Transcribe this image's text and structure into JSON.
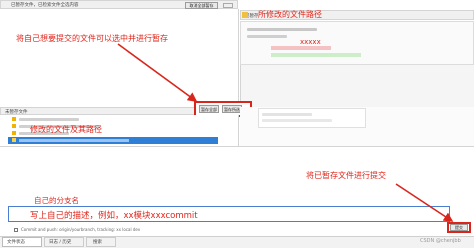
{
  "left_top": {
    "header_label": "已暂存文件，已检索文件全选内容",
    "header_button": "取消全部暂存",
    "annotation": "将自己想要提交的文件可以选中并进行暂存"
  },
  "right_top": {
    "header_label": "已暂存",
    "annotation": "所修改的文件路径",
    "diff_annotation": "xxxxx"
  },
  "left_bottom": {
    "header_label": "未暂存文件",
    "stage_all_button": "暂存全部",
    "stage_selected_button": "暂存所选",
    "annotation": "修改的文件及其路径"
  },
  "bottom": {
    "branch_annotation": "自己的分支名",
    "commit_annotation": "写上自己的描述，例如，xx模块xxxcommit",
    "submit_annotation": "将已暂存文件进行提交",
    "branch_text": "Commit and push: origin/yourbranch, tracking: xx local dev",
    "submit_button": "提交"
  },
  "tabs": [
    {
      "label": "文件状态"
    },
    {
      "label": "日志 / 历史"
    },
    {
      "label": "搜索"
    }
  ],
  "watermark": "CSDN @chenjbb",
  "colors": {
    "annotation_red": "#e1261c",
    "files_highlight": "#2f7fd6"
  }
}
